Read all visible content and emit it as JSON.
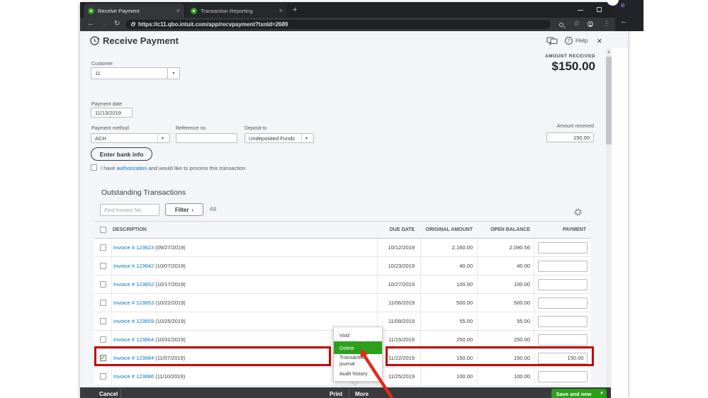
{
  "browser": {
    "tabs": [
      {
        "label": "Receive Payment",
        "active": true
      },
      {
        "label": "Transaction Reporting",
        "active": false
      }
    ],
    "new_tab_label": "+",
    "url": "https://c11.qbo.intuit.com/app/recvpayment?txnId=2689"
  },
  "fragment_window": {
    "profile_initial": "o",
    "back_arrow": "←"
  },
  "page": {
    "title": "Receive Payment",
    "help_label": "Help",
    "amount_received_summary": {
      "label": "AMOUNT RECEIVED",
      "value": "$150.00"
    },
    "fields": {
      "customer": {
        "label": "Customer",
        "value": "11"
      },
      "payment_date": {
        "label": "Payment date",
        "value": "11/13/2019"
      },
      "payment_method": {
        "label": "Payment method",
        "value": "ACH"
      },
      "reference_no": {
        "label": "Reference no.",
        "value": ""
      },
      "deposit_to": {
        "label": "Deposit to",
        "value": "Undeposited Funds"
      },
      "amount_received": {
        "label": "Amount received",
        "value": "150.00"
      }
    },
    "enter_bank_info_label": "Enter bank info",
    "authorization_line": {
      "prefix": "I have ",
      "link": "authorization",
      "suffix": " and would like to process this transaction"
    },
    "outstanding": {
      "heading": "Outstanding Transactions",
      "find_placeholder": "Find Invoice No.",
      "filter_label": "Filter",
      "filter_chevron": "›",
      "all_label": "All",
      "table": {
        "columns": [
          "DESCRIPTION",
          "DUE DATE",
          "ORIGINAL AMOUNT",
          "OPEN BALANCE",
          "PAYMENT"
        ],
        "rows": [
          {
            "invoice": "Invoice # 123623",
            "date_suffix": "(09/27/2019)",
            "due_date": "10/12/2019",
            "original_amount": "2,160.00",
            "open_balance": "2,090.56",
            "payment": "",
            "checked": false
          },
          {
            "invoice": "Invoice # 123642",
            "date_suffix": "(10/07/2019)",
            "due_date": "10/23/2019",
            "original_amount": "40.00",
            "open_balance": "40.00",
            "payment": "",
            "checked": false
          },
          {
            "invoice": "Invoice # 123652",
            "date_suffix": "(10/17/2019)",
            "due_date": "10/27/2019",
            "original_amount": "100.00",
            "open_balance": "100.00",
            "payment": "",
            "checked": false
          },
          {
            "invoice": "Invoice # 123653",
            "date_suffix": "(10/22/2019)",
            "due_date": "11/06/2019",
            "original_amount": "500.00",
            "open_balance": "500.00",
            "payment": "",
            "checked": false
          },
          {
            "invoice": "Invoice # 123659",
            "date_suffix": "(10/25/2019)",
            "due_date": "11/09/2019",
            "original_amount": "55.00",
            "open_balance": "55.00",
            "payment": "",
            "checked": false
          },
          {
            "invoice": "Invoice # 123664",
            "date_suffix": "(10/31/2019)",
            "due_date": "11/15/2019",
            "original_amount": "250.00",
            "open_balance": "250.00",
            "payment": "",
            "checked": false
          },
          {
            "invoice": "Invoice # 123684",
            "date_suffix": "(11/07/2019)",
            "due_date": "11/22/2019",
            "original_amount": "150.00",
            "open_balance": "150.00",
            "payment": "150.00",
            "checked": true
          },
          {
            "invoice": "Invoice # 123686",
            "date_suffix": "(11/10/2019)",
            "due_date": "11/25/2019",
            "original_amount": "100.00",
            "open_balance": "100.00",
            "payment": "",
            "checked": false
          }
        ]
      }
    },
    "context_menu": {
      "items": [
        "Void",
        "Delete",
        "Transaction journal",
        "Audit history"
      ],
      "highlighted": "Delete"
    },
    "footer": {
      "cancel_label": "Cancel",
      "print_label": "Print",
      "more_label": "More",
      "save_label": "Save and new"
    }
  },
  "colors": {
    "brand_green": "#2ca01c",
    "link_blue": "#0077c5",
    "annotation_red": "#c00a0a",
    "footer_dark": "#393a3d"
  }
}
